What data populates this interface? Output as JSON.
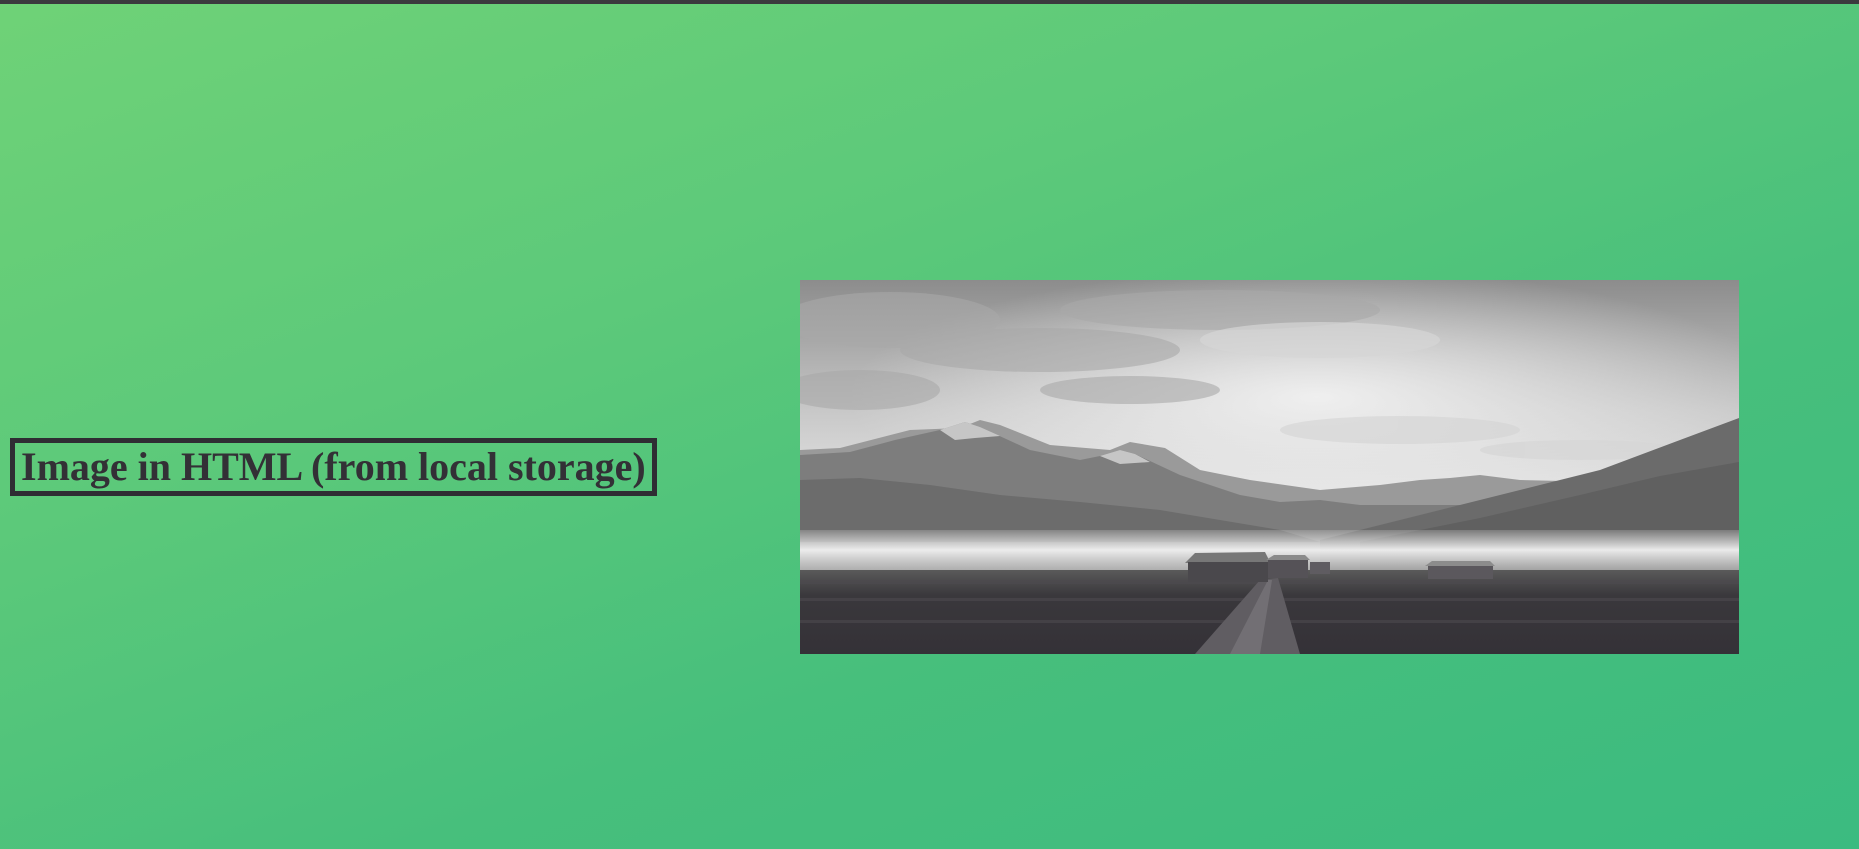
{
  "page": {
    "heading": "Image in HTML (from local storage)"
  },
  "image": {
    "description_icon": "landscape-photo-icon"
  },
  "colors": {
    "background_start": "#6fd277",
    "background_end": "#3bbb80",
    "text": "#333036"
  }
}
